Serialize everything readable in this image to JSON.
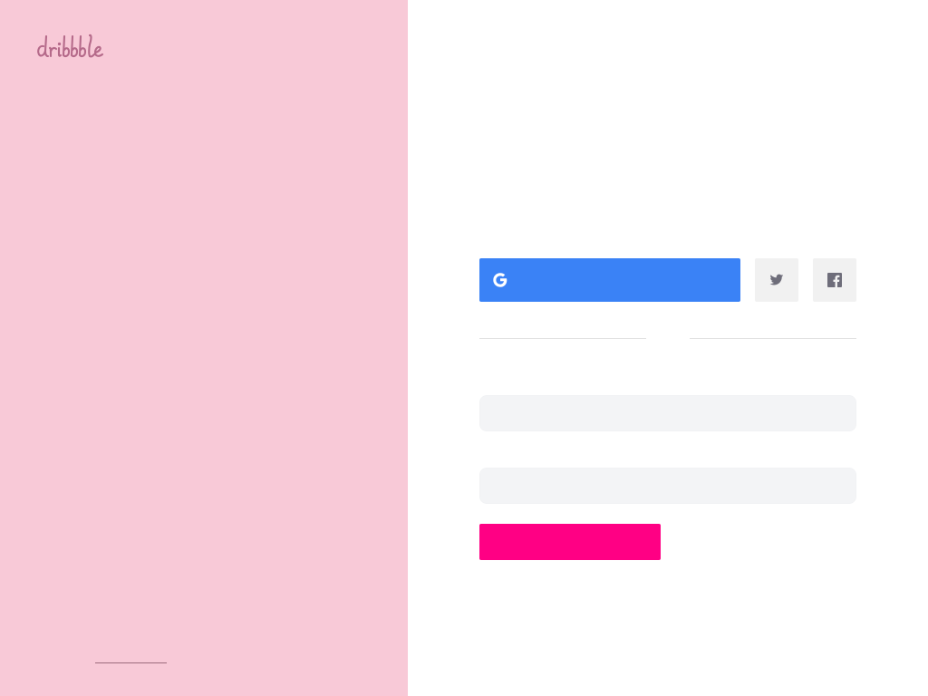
{
  "brand": {
    "logo_text": "dribbble",
    "logo_color": "#b56a8a",
    "panel_color": "#f8c9d7"
  },
  "auth": {
    "google_button": {
      "icon": "google-icon",
      "color": "#3a82f6"
    },
    "twitter_button": {
      "icon": "twitter-icon"
    },
    "facebook_button": {
      "icon": "facebook-icon"
    },
    "submit_button": {
      "color": "#ff0084"
    }
  }
}
